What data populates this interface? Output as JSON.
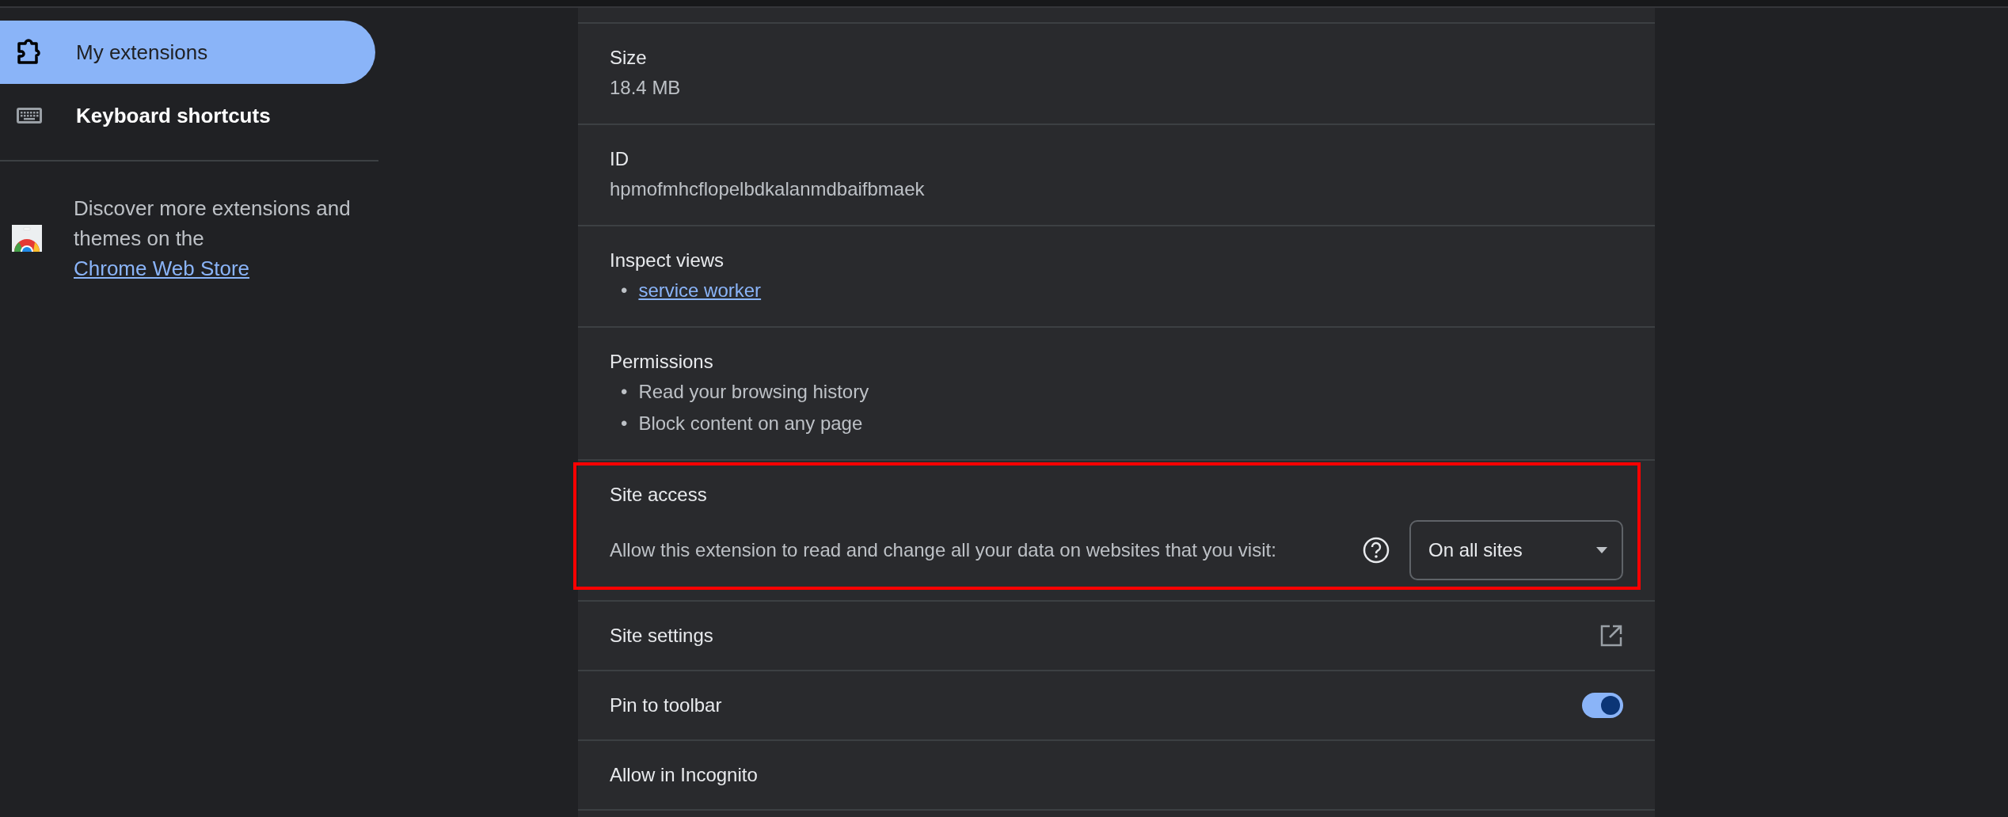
{
  "sidebar": {
    "items": [
      {
        "label": "My extensions",
        "selected": true
      },
      {
        "label": "Keyboard shortcuts",
        "selected": false
      }
    ],
    "promo": {
      "text": "Discover more extensions and themes on the ",
      "link": "Chrome Web Store"
    }
  },
  "details": [
    {
      "kind": "text",
      "label": "Size",
      "value": "18.4 MB"
    },
    {
      "kind": "text",
      "label": "ID",
      "value": "hpmofmhcflopelbdkalanmdbaifbmaek"
    },
    {
      "kind": "list",
      "label": "Inspect views",
      "items": [
        {
          "bullet": "•",
          "text": "service worker",
          "link": true
        }
      ]
    },
    {
      "kind": "list",
      "label": "Permissions",
      "items": [
        {
          "bullet": "•",
          "text": "Read your browsing history",
          "link": false
        },
        {
          "bullet": "•",
          "text": "Block content on any page",
          "link": false
        }
      ]
    },
    {
      "kind": "access",
      "label": "Site access",
      "description": "Allow this extension to read and change all your data on websites that you visit:",
      "select": "On all sites",
      "highlighted": true
    },
    {
      "kind": "external",
      "label": "Site settings"
    },
    {
      "kind": "toggle",
      "label": "Pin to toolbar",
      "on": true
    },
    {
      "kind": "plain",
      "label": "Allow in Incognito"
    }
  ]
}
